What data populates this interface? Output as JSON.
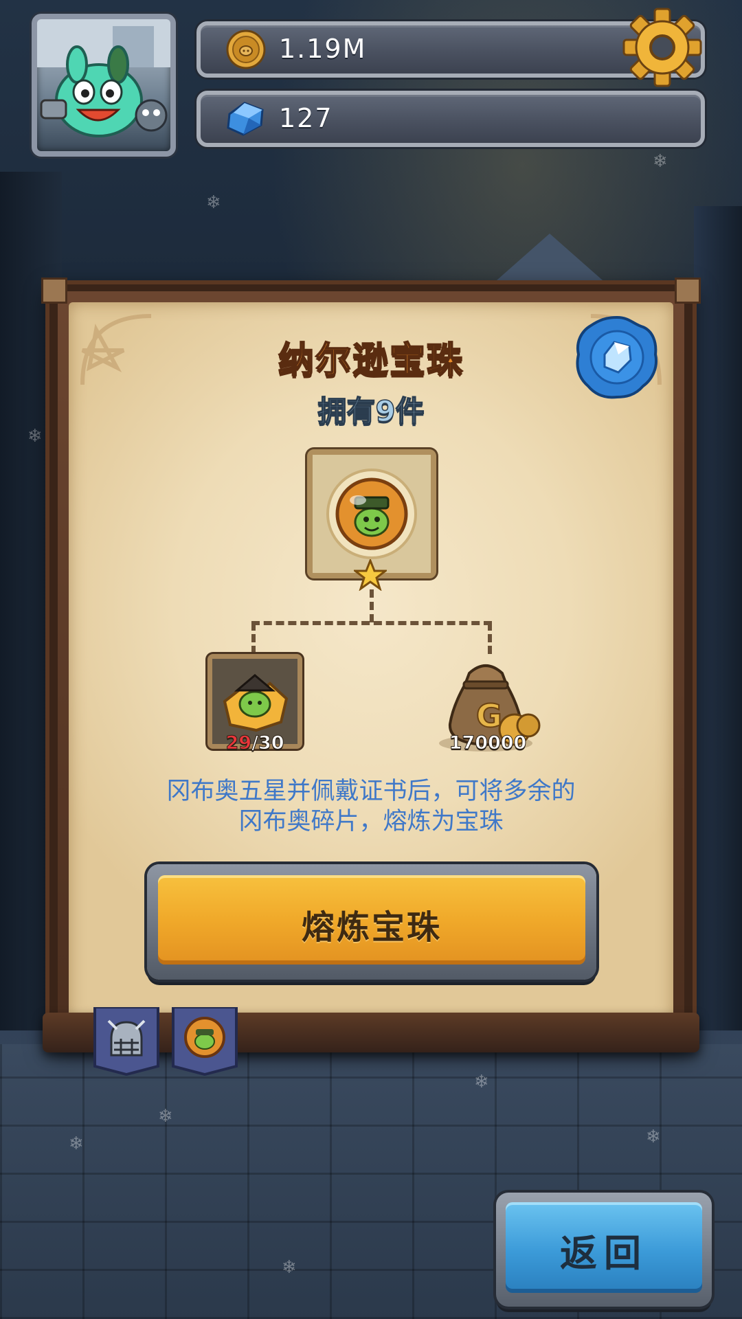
{
  "header": {
    "gold_amount": "1.19M",
    "gem_amount": "127",
    "icons": {
      "avatar": "pet-avatar-icon",
      "gold": "gold-coin-icon",
      "gem": "blue-gem-icon",
      "settings": "gear-icon"
    }
  },
  "panel": {
    "title": "纳尔逊宝珠",
    "owned_text": "拥有9件",
    "seal_icon": "crystal-seal-icon",
    "orb_icon": "orb-item-icon",
    "star_rating": 1,
    "requirements": {
      "fragment": {
        "icon": "hero-fragment-icon",
        "have": "29",
        "separator": "/",
        "need": "30"
      },
      "gold": {
        "icon": "gold-bag-icon",
        "cost": "170000"
      }
    },
    "description_line1": "冈布奥五星并佩戴证书后，可将多余的",
    "description_line2": "冈布奥碎片，熔炼为宝珠",
    "smelt_button_label": "熔炼宝珠"
  },
  "tabs": [
    {
      "icon": "helmet-tab-icon"
    },
    {
      "icon": "orb-tab-icon"
    }
  ],
  "back_button_label": "返回",
  "colors": {
    "title": "#e98c2a",
    "subtitle": "#a9cde6",
    "description": "#3f78c8",
    "fragment_have": "#e8353a",
    "smelt_button": "#f0a92a",
    "back_button": "#3b9ad8"
  }
}
